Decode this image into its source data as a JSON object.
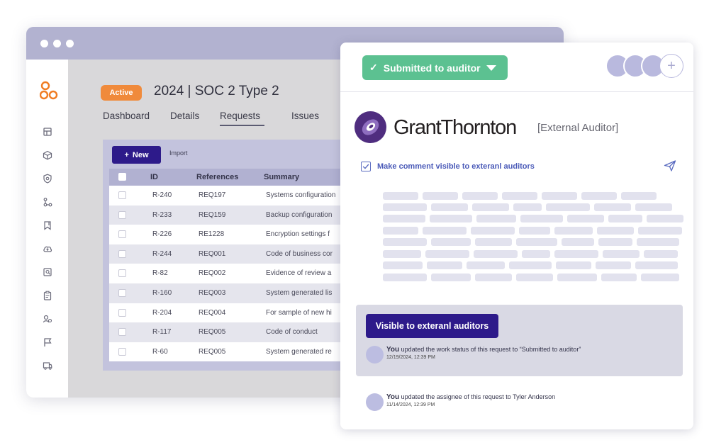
{
  "window": {
    "project": {
      "badge": "Active",
      "title": "2024 | SOC 2 Type 2"
    },
    "tabs": [
      {
        "label": "Dashboard",
        "active": false
      },
      {
        "label": "Details",
        "active": false
      },
      {
        "label": "Requests",
        "active": true
      },
      {
        "label": "Issues",
        "active": false
      }
    ],
    "toolbar": {
      "new_label": "New",
      "import_label": "Import"
    },
    "table": {
      "headers": [
        "ID",
        "References",
        "Summary"
      ],
      "rows": [
        {
          "id": "R-240",
          "ref": "REQ197",
          "summary": "Systems configuration"
        },
        {
          "id": "R-233",
          "ref": "REQ159",
          "summary": "Backup configuration"
        },
        {
          "id": "R-226",
          "ref": "RE1228",
          "summary": "Encryption settings f"
        },
        {
          "id": "R-244",
          "ref": "REQ001",
          "summary": "Code of business cor"
        },
        {
          "id": "R-82",
          "ref": "REQ002",
          "summary": "Evidence of review a"
        },
        {
          "id": "R-160",
          "ref": "REQ003",
          "summary": "System generated lis"
        },
        {
          "id": "R-204",
          "ref": "REQ004",
          "summary": "For sample of new hi"
        },
        {
          "id": "R-117",
          "ref": "REQ005",
          "summary": "Code of conduct"
        },
        {
          "id": "R-60",
          "ref": "REQ005",
          "summary": "System generated re"
        }
      ]
    },
    "sidebar_icons": [
      "logo-icon",
      "dashboard-icon",
      "cube-icon",
      "shield-icon",
      "workflow-icon",
      "bookmark-icon",
      "cloud-upload-icon",
      "report-icon",
      "clipboard-icon",
      "vendors-icon",
      "flag-icon",
      "truck-icon"
    ]
  },
  "card": {
    "status_label": "Submitted to auditor",
    "auditor": {
      "name": "GrantThornton",
      "role": "[External Auditor]"
    },
    "visibility_label": "Make comment visible to exteranl auditors",
    "visible_button": "Visible to exteranl auditors",
    "activity": [
      {
        "who": "You",
        "text": "updated the work status of this request to “Submitted to auditor”",
        "time": "12/19/2024, 12:39 PM"
      },
      {
        "who": "You",
        "text": "updated the assignee of this request to Tyler Anderson",
        "time": "11/14/2024, 12:39 PM"
      }
    ]
  },
  "colors": {
    "accent_purple": "#2d1a8a",
    "status_green": "#5cc191",
    "active_orange": "#f08a3b",
    "gt_purple": "#4f2d7f"
  }
}
